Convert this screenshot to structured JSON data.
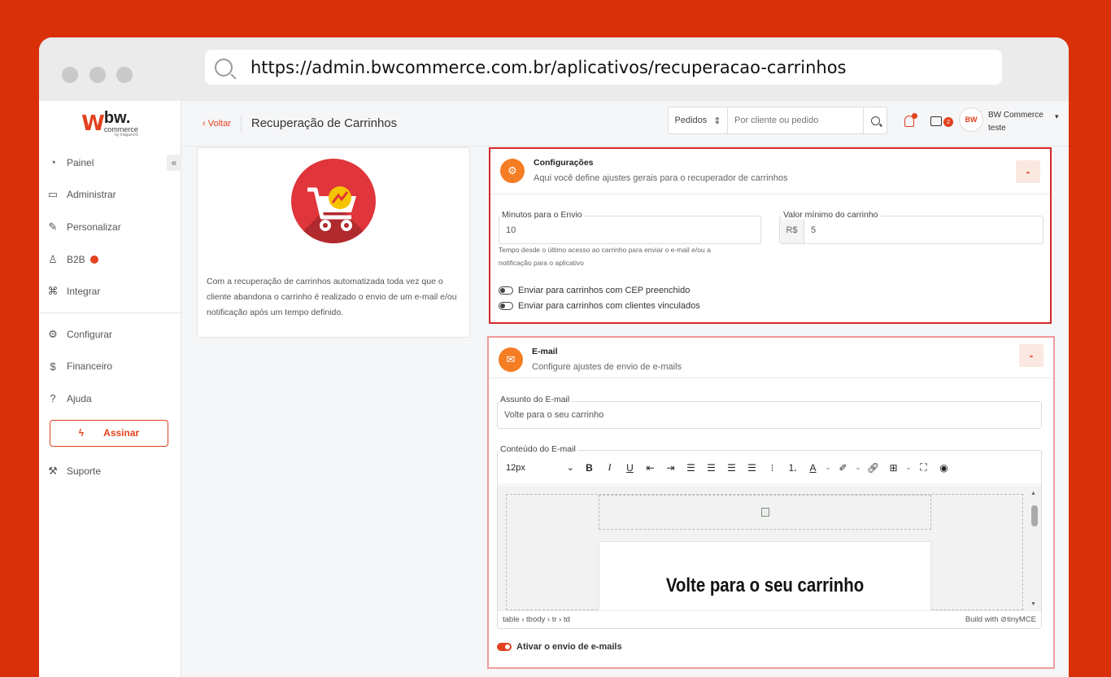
{
  "browser": {
    "url": "https://admin.bwcommerce.com.br/aplicativos/recuperacao-carrinhos"
  },
  "logo": {
    "mark": "W",
    "name": "bw.",
    "sub": "commerce",
    "tiny": "by magazord"
  },
  "sidebar": {
    "items": [
      {
        "label": "Painel",
        "icon": "clock-icon"
      },
      {
        "label": "Administrar",
        "icon": "monitor-icon"
      },
      {
        "label": "Personalizar",
        "icon": "pen-icon"
      },
      {
        "label": "B2B",
        "icon": "users-icon"
      },
      {
        "label": "Integrar",
        "icon": "command-icon"
      }
    ],
    "items2": [
      {
        "label": "Configurar",
        "icon": "gear-icon"
      },
      {
        "label": "Financeiro",
        "icon": "dollar-icon"
      },
      {
        "label": "Ajuda",
        "icon": "help-icon"
      }
    ],
    "assinar": "Assinar",
    "suporte": "Suporte",
    "collapse": "«"
  },
  "header": {
    "back": "Voltar",
    "title": "Recuperação de Carrinhos",
    "search_select": "Pedidos",
    "search_placeholder": "Por cliente ou pedido",
    "chat_count": "2",
    "avatar": "BW",
    "user_name": "BW Commerce",
    "user_sub": "teste"
  },
  "app_card": {
    "description": "Com a recuperação de carrinhos automatizada toda vez que o cliente abandona o carrinho é realizado o envio de um e-mail e/ou notificação após um tempo definido."
  },
  "config": {
    "title": "Configurações",
    "subtitle": "Aqui você define ajustes gerais para o recuperador de carrinhos",
    "toggle": "-",
    "minutes_label": "Minutos para o Envio",
    "minutes_value": "10",
    "min_value_label": "Valor mínimo do carrinho",
    "currency": "R$",
    "min_value": "5",
    "hint": "Tempo desde o último acesso ao carrinho para enviar o e-mail e/ou a notificação para o aplicativo",
    "switch1": "Enviar para carrinhos com CEP preenchido",
    "switch2": "Enviar para carrinhos com clientes vinculados"
  },
  "email": {
    "title": "E-mail",
    "subtitle": "Configure ajustes de envio de e-mails",
    "toggle": "-",
    "subject_label": "Assunto do E-mail",
    "subject_value": "Volte para o seu carrinho",
    "content_label": "Conteúdo do E-mail",
    "font_size": "12px",
    "heading": "Volte para o seu carrinho",
    "path": "table › tbody › tr › td",
    "branding": "Build with ⊘tinyMCE",
    "activate": "Ativar o envio de e-mails"
  }
}
